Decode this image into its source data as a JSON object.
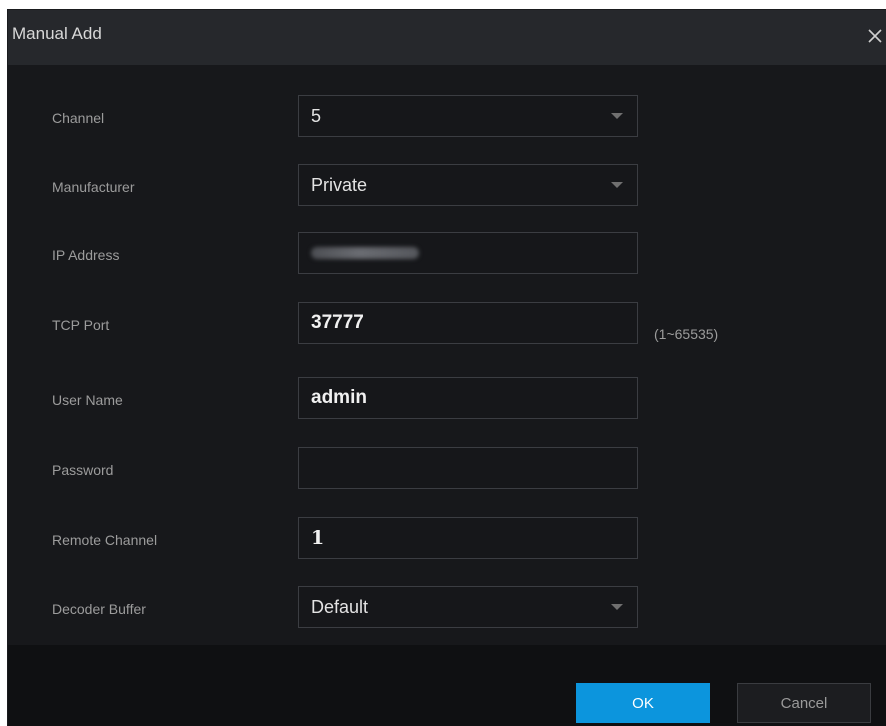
{
  "dialog": {
    "title": "Manual Add",
    "close_icon": "close-icon"
  },
  "form": {
    "channel": {
      "label": "Channel",
      "value": "5"
    },
    "manufacturer": {
      "label": "Manufacturer",
      "value": "Private"
    },
    "ip_address": {
      "label": "IP Address",
      "value_obscured": true
    },
    "tcp_port": {
      "label": "TCP Port",
      "value": "37777",
      "hint": "(1~65535)"
    },
    "user_name": {
      "label": "User Name",
      "value": "admin"
    },
    "password": {
      "label": "Password",
      "value": ""
    },
    "remote_channel": {
      "label": "Remote Channel",
      "value": "1"
    },
    "decoder_buffer": {
      "label": "Decoder Buffer",
      "value": "Default"
    }
  },
  "buttons": {
    "ok": "OK",
    "cancel": "Cancel"
  },
  "colors": {
    "accent": "#0c95dd",
    "background": "#17181b",
    "titlebar": "#26282c"
  }
}
